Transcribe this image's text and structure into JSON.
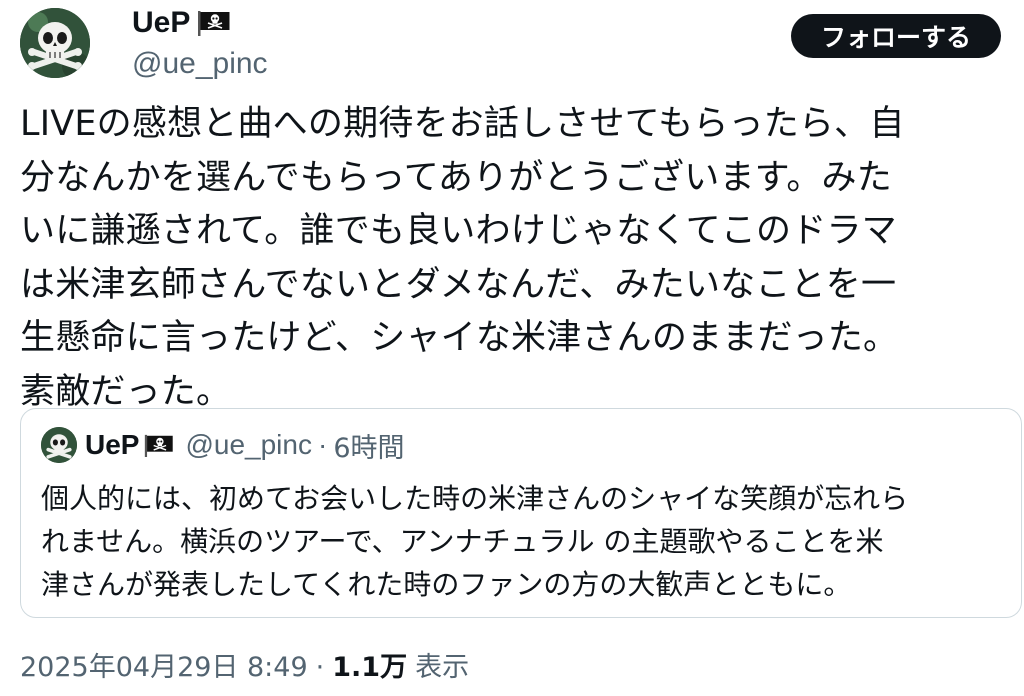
{
  "author": {
    "display_name": "UeP",
    "handle": "@ue_pinc",
    "avatar_icon": "skull-crossbones-icon",
    "badge_icon": "pirate-flag-icon"
  },
  "follow_button": {
    "label": "フォローする"
  },
  "tweet": {
    "lines": [
      "LIVEの感想と曲への期待をお話しさせてもらったら、自",
      "分なんかを選んでもらってありがとうございます。みた",
      "いに謙遜されて。誰でも良いわけじゃなくてこのドラマ",
      "は米津玄師さんでないとダメなんだ、みたいなことを一",
      "生懸命に言ったけど、シャイな米津さんのままだった。",
      "素敵だった。"
    ]
  },
  "quote": {
    "display_name": "UeP",
    "handle": "@ue_pinc",
    "separator": "·",
    "time": "6時間",
    "lines": [
      "個人的には、初めてお会いした時の米津さんのシャイな笑顔が忘れら",
      "れません。横浜のツアーで、アンナチュラル の主題歌やることを米",
      "津さんが発表したしてくれた時のファンの方の大歓声とともに。"
    ]
  },
  "meta": {
    "timestamp": "2025年04月29日 8:49",
    "separator": "·",
    "views_count": "1.1万",
    "views_label": "表示"
  },
  "colors": {
    "text_primary": "#0f1419",
    "text_secondary": "#536471",
    "border": "#cfd9de",
    "button_bg": "#0f1419",
    "button_text": "#ffffff"
  }
}
